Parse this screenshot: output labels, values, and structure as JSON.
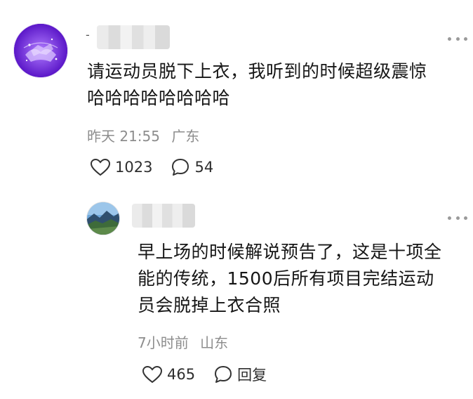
{
  "comment": {
    "author_prefix": "-",
    "text_line1": "请运动员脱下上衣，我听到的时候超级震惊",
    "text_line2": "哈哈哈哈哈哈哈哈",
    "time": "昨天 21:55",
    "location": "广东",
    "likes": "1023",
    "replies": "54",
    "like_icon": "heart-icon",
    "reply_icon": "comment-bubble-icon",
    "more_icon": "more-icon"
  },
  "reply": {
    "text_line1": "早上场的时候解说预告了，这是十项全",
    "text_line2": "能的传统，1500后所有项目完结运动",
    "text_line3": "员会脱掉上衣合照",
    "time": "7小时前",
    "location": "山东",
    "likes": "465",
    "reply_label": "回复",
    "like_icon": "heart-icon",
    "reply_icon": "comment-bubble-icon",
    "more_icon": "more-icon"
  }
}
